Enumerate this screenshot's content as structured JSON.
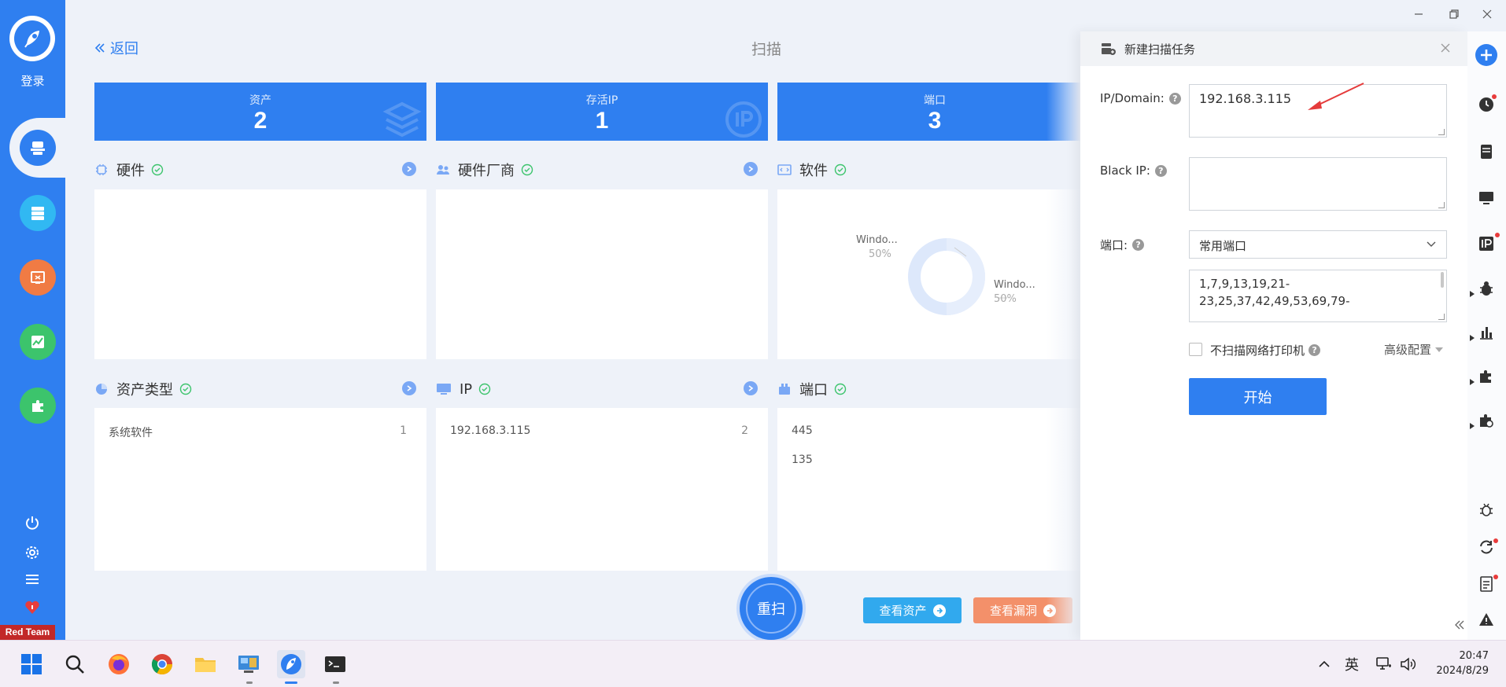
{
  "sidebar": {
    "login_label": "登录",
    "badge": "Red Team",
    "colors": {
      "blue": "#2f7ff0",
      "teal": "#31b8f2",
      "orange": "#f07b44",
      "green": "#3cc46c",
      "red": "#c22828"
    }
  },
  "topbar": {
    "back_label": "返回",
    "title": "扫描"
  },
  "stats": [
    {
      "label": "资产",
      "value": "2"
    },
    {
      "label": "存活IP",
      "value": "1"
    },
    {
      "label": "端口",
      "value": "3"
    }
  ],
  "panels": {
    "hardware": {
      "title": "硬件"
    },
    "vendor": {
      "title": "硬件厂商"
    },
    "software": {
      "title": "软件",
      "donut": [
        {
          "label": "Windo...",
          "percent": "50%"
        },
        {
          "label": "Windo...",
          "percent": "50%"
        }
      ]
    },
    "asset_type": {
      "title": "资产类型",
      "rows": [
        {
          "name": "系统软件",
          "count": "1"
        }
      ]
    },
    "ip": {
      "title": "IP",
      "rows": [
        {
          "name": "192.168.3.115",
          "count": "2"
        }
      ]
    },
    "port": {
      "title": "端口",
      "rows": [
        {
          "name": "445"
        },
        {
          "name": "135"
        }
      ]
    }
  },
  "actions": {
    "rescan": "重扫",
    "view_assets": "查看资产",
    "view_vulns": "查看漏洞"
  },
  "dialog": {
    "title": "新建扫描任务",
    "ip_label": "IP/Domain:",
    "ip_value": "192.168.3.115",
    "black_label": "Black IP:",
    "black_value": "",
    "port_label": "端口:",
    "port_select": "常用端口",
    "port_list_line1": "1,7,9,13,19,21-",
    "port_list_line2": "23,25,37,42,49,53,69,79-",
    "no_printer_label": "不扫描网络打印机",
    "advanced_label": "高级配置",
    "start_label": "开始"
  },
  "taskbar": {
    "ime": "英",
    "time": "20:47",
    "date": "2024/8/29"
  }
}
